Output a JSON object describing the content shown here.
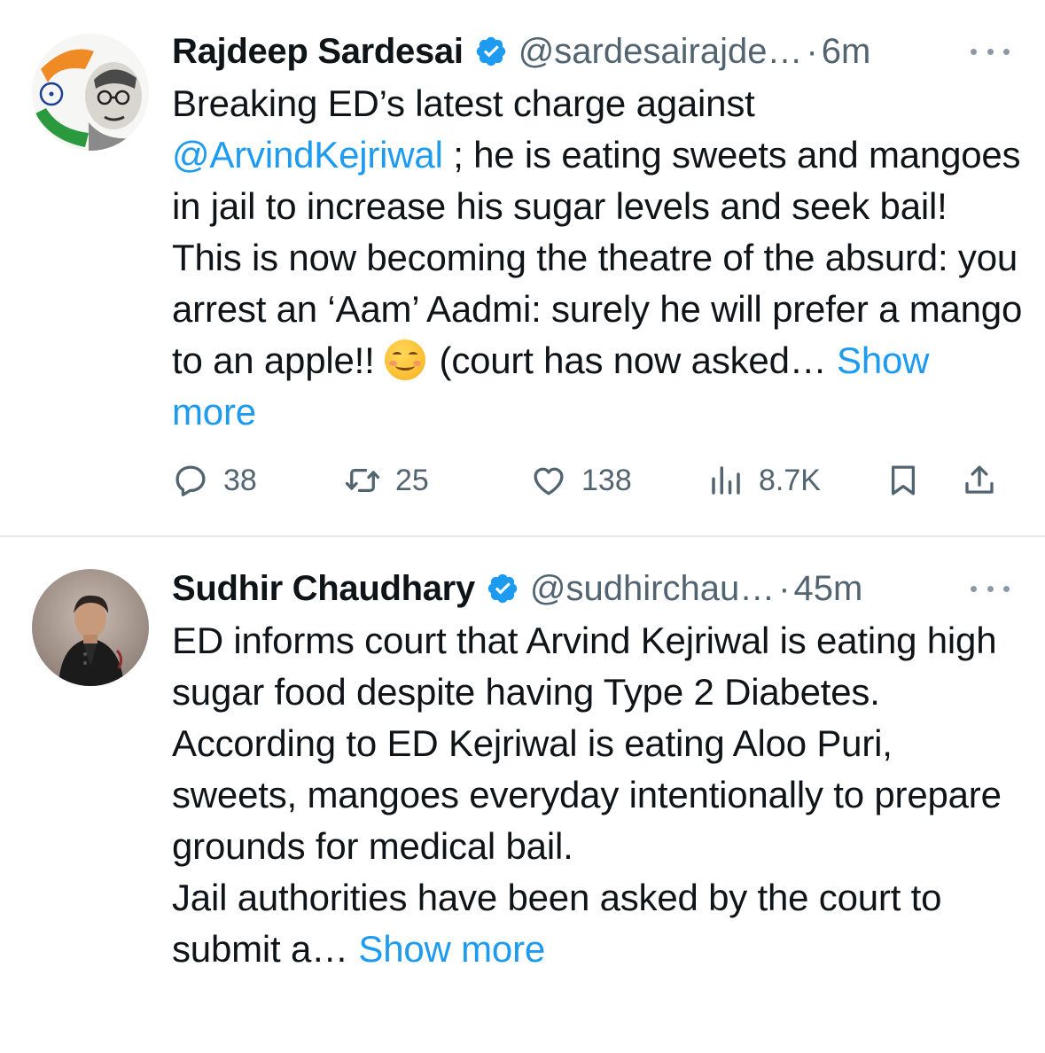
{
  "colors": {
    "link": "#1d9bf0",
    "muted": "#536471",
    "verified": "#1d9bf0",
    "text": "#0f1419"
  },
  "tweets": [
    {
      "author": {
        "name": "Rajdeep Sardesai",
        "handle": "@sardesairajde…",
        "separator": "·",
        "time": "6m",
        "verified": true,
        "avatar": "avatar-rajdeep"
      },
      "body": {
        "segments": [
          {
            "text": "Breaking ED’s latest charge against "
          },
          {
            "text": "@ArvindKejriwal",
            "link": true
          },
          {
            "text": " ; he is eating sweets and mangoes in jail to increase his sugar levels and seek bail! This is now becoming the theatre of the absurd: you arrest an  ‘Aam’ Aadmi: surely he will prefer a mango to an apple!! "
          },
          {
            "emoji": "smiling-face-emoji"
          },
          {
            "text": " (court has now asked… "
          },
          {
            "text": "Show more",
            "link": true
          }
        ]
      },
      "metrics": {
        "replies": "38",
        "retweets": "25",
        "likes": "138",
        "views": "8.7K"
      }
    },
    {
      "author": {
        "name": "Sudhir Chaudhary",
        "handle": "@sudhirchau…",
        "separator": "·",
        "time": "45m",
        "verified": true,
        "avatar": "avatar-sudhir"
      },
      "body": {
        "segments": [
          {
            "text": "ED informs court that Arvind Kejriwal is eating high sugar food despite having Type 2 Diabetes."
          },
          {
            "break": true
          },
          {
            "text": "According to ED Kejriwal is eating Aloo Puri, sweets, mangoes everyday intentionally to prepare grounds for medical bail."
          },
          {
            "break": true
          },
          {
            "text": "Jail authorities have been asked by the court to submit a… "
          },
          {
            "text": "Show more",
            "link": true
          }
        ]
      }
    }
  ]
}
